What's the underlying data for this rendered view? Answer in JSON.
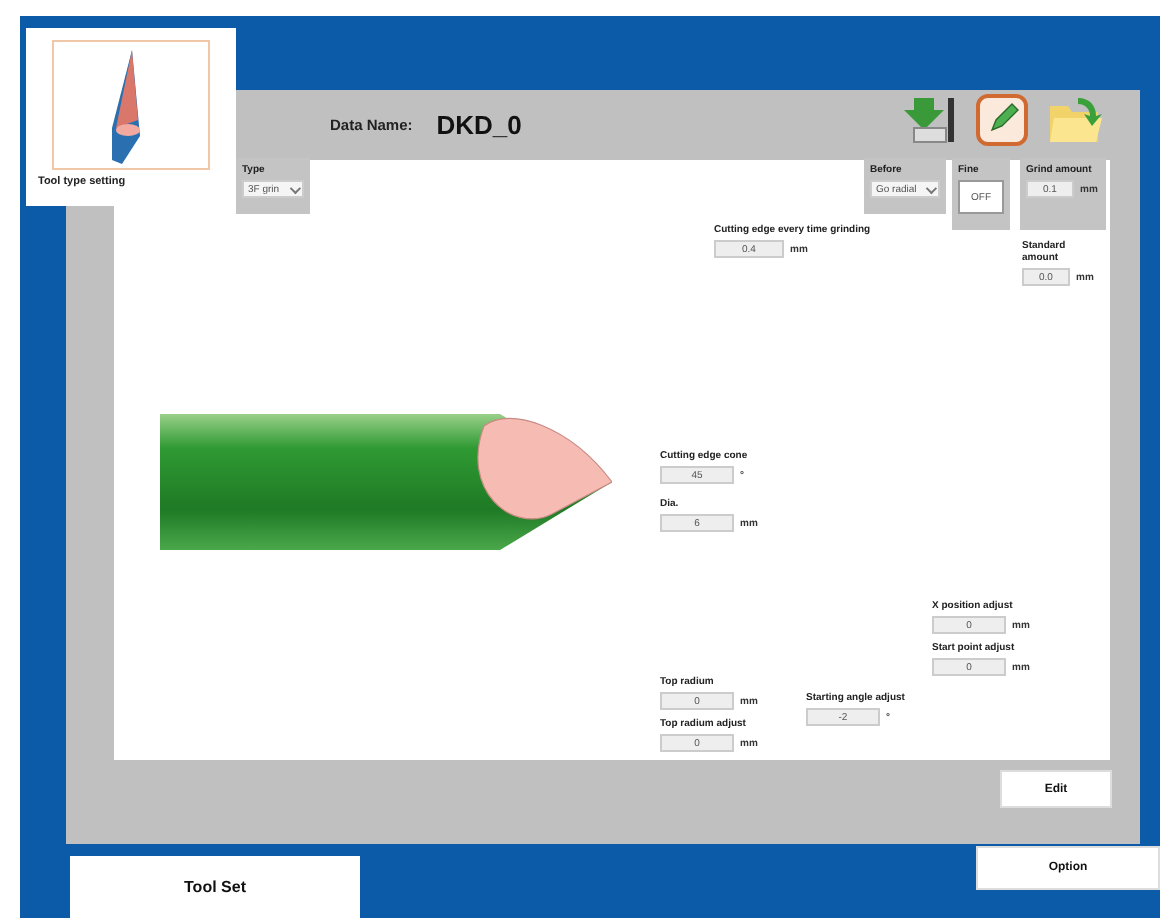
{
  "header": {
    "label": "Data Name:",
    "value": "DKD_0"
  },
  "tool_card": {
    "label": "Tool type setting"
  },
  "toolbar": [
    {
      "kind": "export"
    },
    {
      "kind": "edit"
    },
    {
      "kind": "open"
    }
  ],
  "fields": [
    {
      "kind": "dropdown",
      "label": "Type",
      "value": "3F grin"
    },
    {
      "kind": "dropdown",
      "label": "Before",
      "value": "Go radial"
    },
    {
      "kind": "toggle",
      "label": "Fine",
      "value": "OFF"
    },
    {
      "kind": "number",
      "label": "Grind amount",
      "value": "0.1",
      "unit": "mm"
    },
    {
      "kind": "number",
      "label": "Standard amount",
      "value": "0.0",
      "unit": "mm"
    },
    {
      "kind": "number",
      "label": "Cutting edge every time grinding",
      "value": "0.4",
      "unit": "mm"
    },
    {
      "kind": "number",
      "label": "Cutting edge cone",
      "value": "45",
      "unit": "°"
    },
    {
      "kind": "number",
      "label": "Dia.",
      "value": "6",
      "unit": "mm"
    },
    {
      "kind": "number",
      "label": "X position adjust",
      "value": "0",
      "unit": "mm"
    },
    {
      "kind": "number",
      "label": "Start point adjust",
      "value": "0",
      "unit": "mm"
    },
    {
      "kind": "number",
      "label": "Top radium",
      "value": "0",
      "unit": "mm"
    },
    {
      "kind": "number",
      "label": "Top radium adjust",
      "value": "0",
      "unit": "mm"
    },
    {
      "kind": "number",
      "label": "Starting angle adjust",
      "value": "-2",
      "unit": "°"
    }
  ],
  "buttons": {
    "edit": "Edit",
    "option": "Option"
  },
  "tabs": [
    {
      "label": "Tool Set",
      "selected": true
    }
  ]
}
